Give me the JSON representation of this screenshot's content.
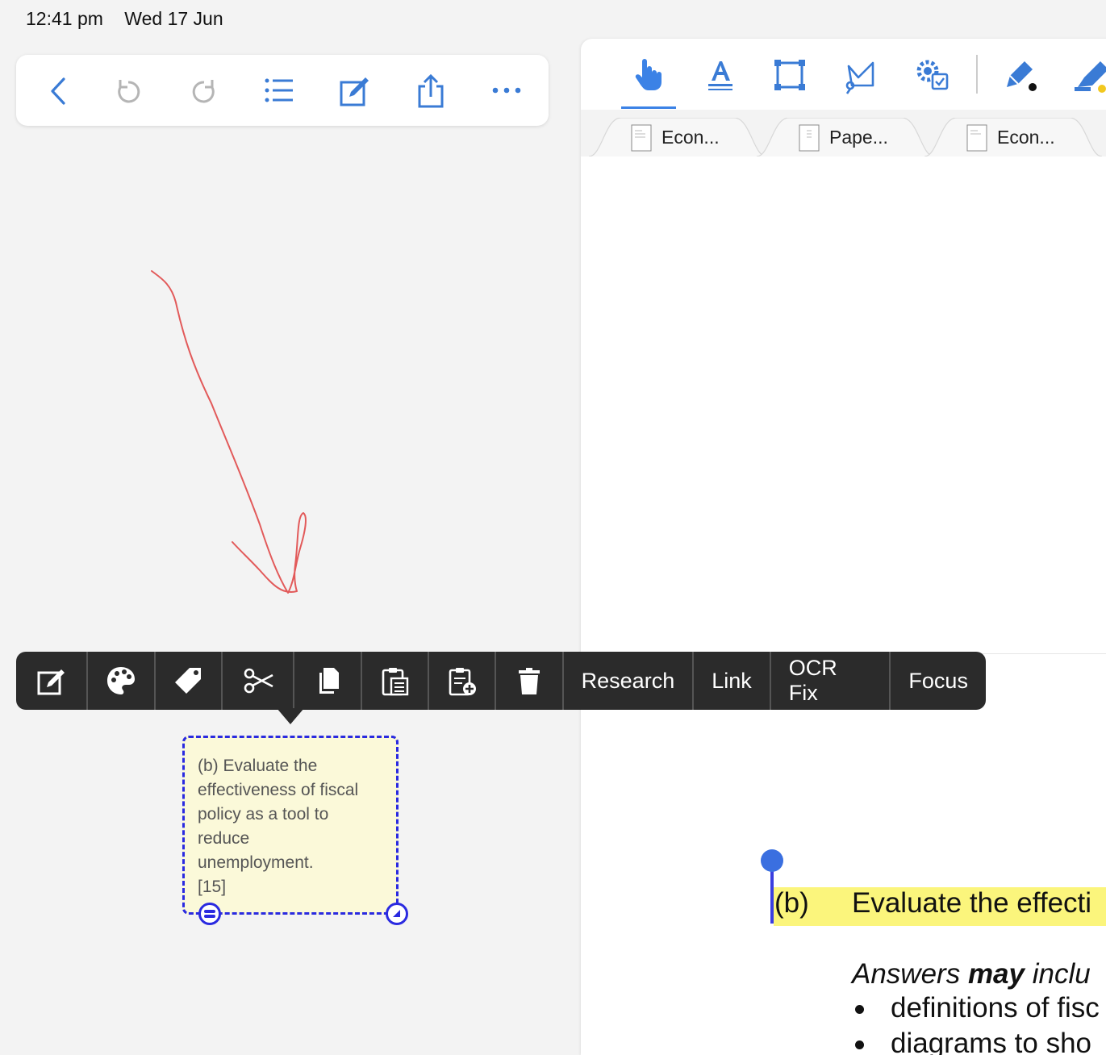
{
  "status_bar": {
    "time": "12:41 pm",
    "date": "Wed 17 Jun"
  },
  "left_toolbar": {
    "buttons": [
      "back-icon",
      "undo-icon",
      "redo-icon",
      "outline-list-icon",
      "edit-note-icon",
      "share-icon",
      "more-icon"
    ]
  },
  "annotation_toolbar": {
    "tools": [
      "hand-pointer-icon",
      "text-highlight-icon",
      "crop-frame-icon",
      "lasso-icon",
      "settings-gear-icon",
      "pen-icon",
      "highlighter-icon"
    ],
    "active_tool": "hand-pointer-icon",
    "accent": "#3b82e6"
  },
  "tabs": [
    {
      "label": "Econ..."
    },
    {
      "label": "Pape..."
    },
    {
      "label": "Econ..."
    }
  ],
  "context_menu": {
    "icon_items": [
      "edit-icon",
      "palette-icon",
      "tag-icon",
      "scissors-icon",
      "copy-icon",
      "paste-icon",
      "paste-add-icon",
      "trash-icon"
    ],
    "text_items": [
      "Research",
      "Link",
      "OCR Fix",
      "Focus"
    ]
  },
  "sticky_note": {
    "lines": [
      "(b) Evaluate the",
      "effectiveness of fiscal",
      "policy as a tool to",
      "reduce",
      "unemployment.",
      "[15]"
    ]
  },
  "document": {
    "question_label": "(b)",
    "question_text": "Evaluate the effecti",
    "answers_prefix": "Answers ",
    "answers_bold": "may",
    "answers_suffix": " inclu",
    "bullets": [
      "definitions of fisc",
      "diagrams to sho"
    ]
  },
  "colors": {
    "ink_red": "#e25a5a",
    "selection_blue": "#2a2ae0",
    "highlight_yellow": "#fbf57c",
    "menu_bg": "#2b2b2b",
    "toolbar_blue": "#3a7bd5"
  }
}
